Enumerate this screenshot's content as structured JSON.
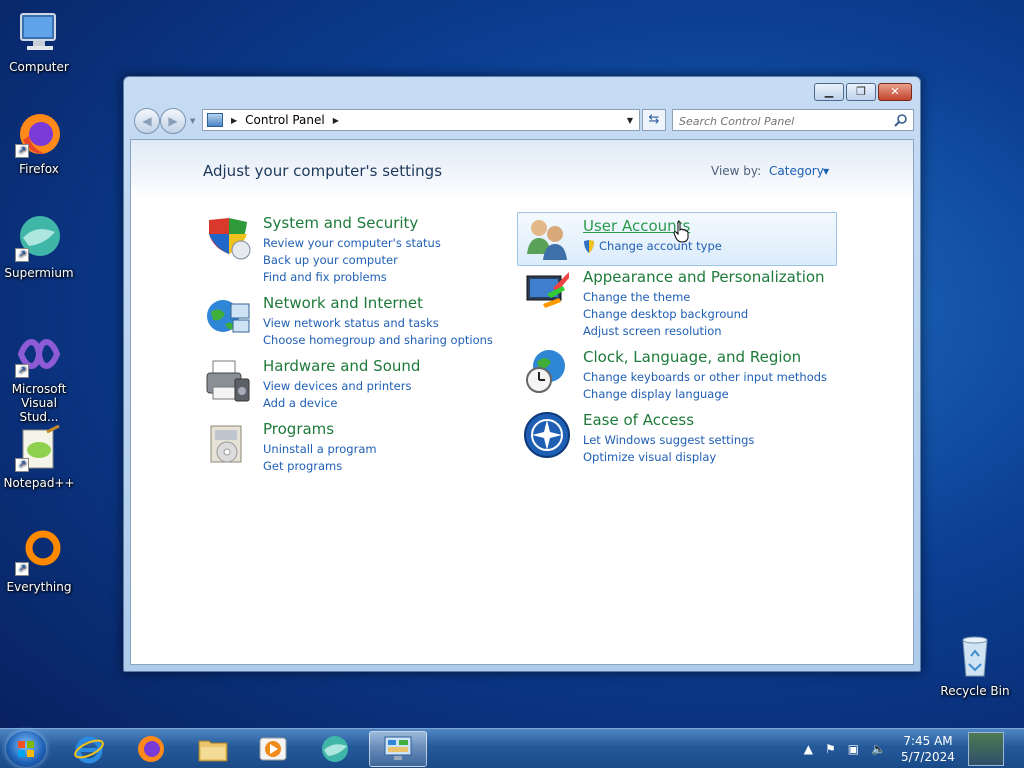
{
  "desktop": {
    "icons": [
      {
        "label": "Computer"
      },
      {
        "label": "Firefox"
      },
      {
        "label": "Supermium"
      },
      {
        "label": "Microsoft Visual Stud..."
      },
      {
        "label": "Notepad++"
      },
      {
        "label": "Everything"
      },
      {
        "label": "Recycle Bin"
      }
    ]
  },
  "window": {
    "address": {
      "crumb": "Control Panel"
    },
    "search_placeholder": "Search Control Panel",
    "title": "Adjust your computer's settings",
    "view_by_label": "View by:",
    "view_by_value": "Category",
    "categories": [
      {
        "title": "System and Security",
        "links": [
          "Review your computer's status",
          "Back up your computer",
          "Find and fix problems"
        ]
      },
      {
        "title": "Network and Internet",
        "links": [
          "View network status and tasks",
          "Choose homegroup and sharing options"
        ]
      },
      {
        "title": "Hardware and Sound",
        "links": [
          "View devices and printers",
          "Add a device"
        ]
      },
      {
        "title": "Programs",
        "links": [
          "Uninstall a program",
          "Get programs"
        ]
      },
      {
        "title": "User Accounts",
        "links": [
          "Change account type"
        ]
      },
      {
        "title": "Appearance and Personalization",
        "links": [
          "Change the theme",
          "Change desktop background",
          "Adjust screen resolution"
        ]
      },
      {
        "title": "Clock, Language, and Region",
        "links": [
          "Change keyboards or other input methods",
          "Change display language"
        ]
      },
      {
        "title": "Ease of Access",
        "links": [
          "Let Windows suggest settings",
          "Optimize visual display"
        ]
      }
    ]
  },
  "taskbar": {
    "time": "7:45 AM",
    "date": "5/7/2024"
  }
}
